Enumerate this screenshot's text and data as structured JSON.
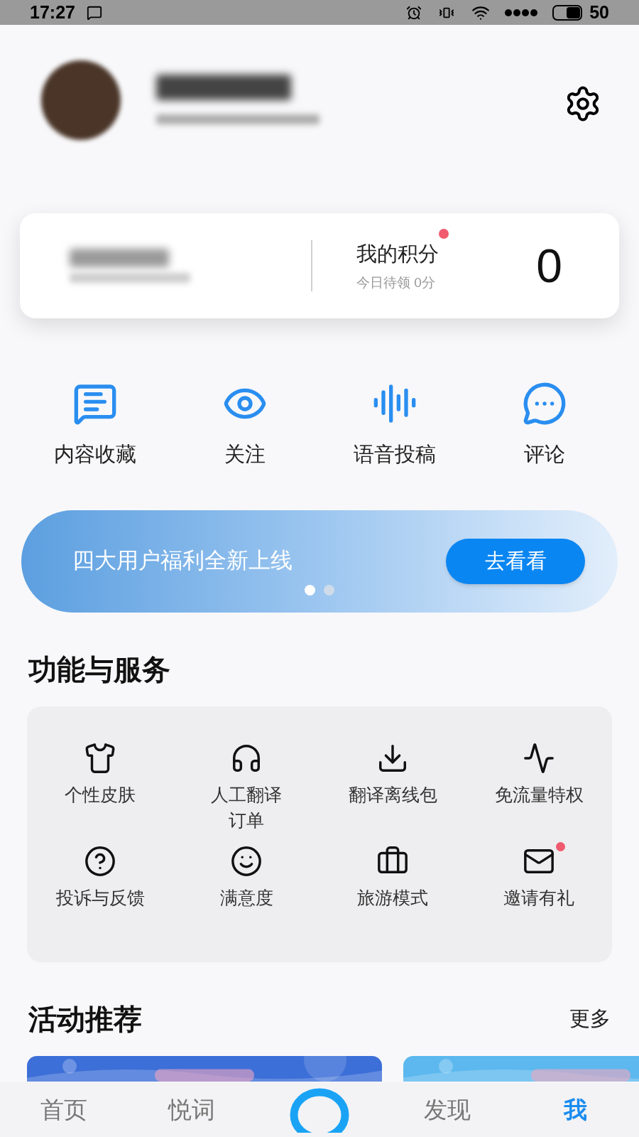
{
  "status_bar": {
    "time": "17:27",
    "battery": "50"
  },
  "points_card": {
    "title": "我的积分",
    "subtitle": "今日待领 0分",
    "value": "0",
    "new_dot": true
  },
  "shortcuts": [
    {
      "label": "内容收藏"
    },
    {
      "label": "关注"
    },
    {
      "label": "语音投稿"
    },
    {
      "label": "评论"
    }
  ],
  "banner": {
    "text": "四大用户福利全新上线",
    "button": "去看看",
    "dots": [
      {
        "selected": true
      },
      {
        "selected": false
      }
    ]
  },
  "services": {
    "title": "功能与服务",
    "items": [
      {
        "lines": [
          "个性皮肤"
        ],
        "new_dot": false
      },
      {
        "lines": [
          "人工翻译",
          "订单"
        ],
        "new_dot": false
      },
      {
        "lines": [
          "翻译离线包"
        ],
        "new_dot": false
      },
      {
        "lines": [
          "免流量特权"
        ],
        "new_dot": false
      },
      {
        "lines": [
          "投诉与反馈"
        ],
        "new_dot": false
      },
      {
        "lines": [
          "满意度"
        ],
        "new_dot": false
      },
      {
        "lines": [
          "旅游模式"
        ],
        "new_dot": false
      },
      {
        "lines": [
          "邀请有礼"
        ],
        "new_dot": true
      }
    ]
  },
  "activities": {
    "title": "活动推荐",
    "more": "更多"
  },
  "tab_bar": [
    {
      "kind": "text",
      "label": "首页",
      "selected": false
    },
    {
      "kind": "text",
      "label": "悦词",
      "selected": false
    },
    {
      "kind": "assistant",
      "selected": false
    },
    {
      "kind": "text",
      "label": "发现",
      "selected": false
    },
    {
      "kind": "text",
      "label": "我",
      "selected": true
    }
  ]
}
